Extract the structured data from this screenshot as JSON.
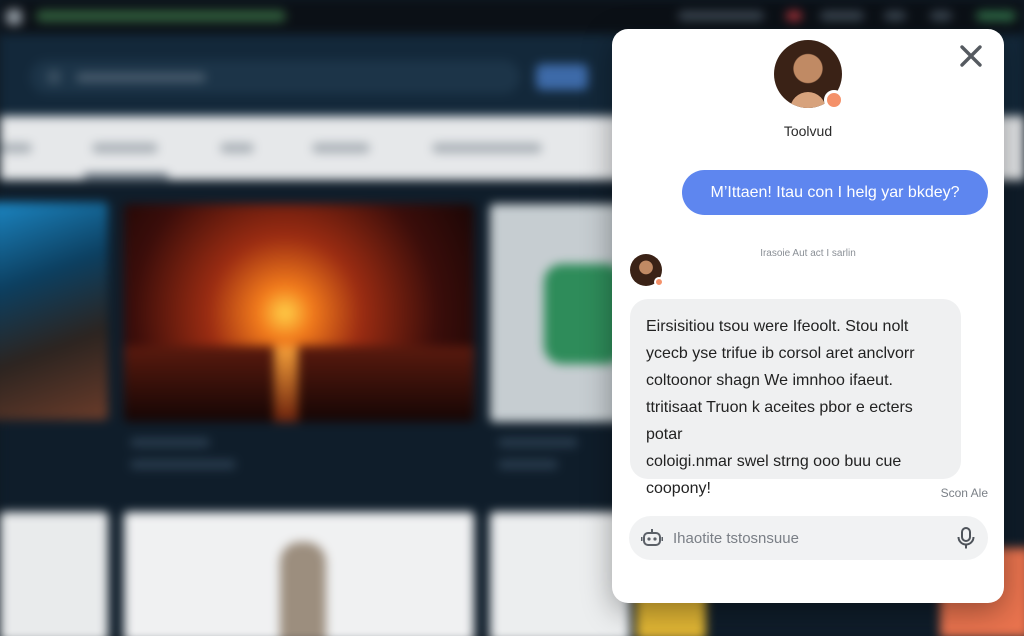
{
  "colors": {
    "accent": "#5e86ef",
    "status_online": "#f4916a",
    "popup_background": "#ffffff",
    "bot_bubble": "#eff0f1"
  },
  "chat": {
    "agent_name": "Toolvud",
    "agent_status_color": "#f4916a",
    "messages": [
      {
        "sender": "user",
        "text": "M’Ittaen! Itau con I helg yar bkdey?"
      },
      {
        "sender": "bot",
        "timestamp": "Irasoie Aut act I sarlin",
        "lines": [
          "Eirsisitiou tsou were Ifeoolt. Stou nolt",
          "ycecb yse trifue ib corsol aret anclvorr",
          "coltoonor shagn We imnhoo ifaeut.",
          "ttritisaat Truon k aceites pbor e ecters potar",
          "coloigi.nmar swel strng ooo buu cue",
          "coopony!"
        ]
      }
    ],
    "read_label": "Scon Ale",
    "input": {
      "placeholder": "Ihaotite tstosnsuue",
      "value": ""
    }
  },
  "icons": {
    "close": "close-icon",
    "bot": "bot-icon",
    "mic": "mic-icon"
  }
}
